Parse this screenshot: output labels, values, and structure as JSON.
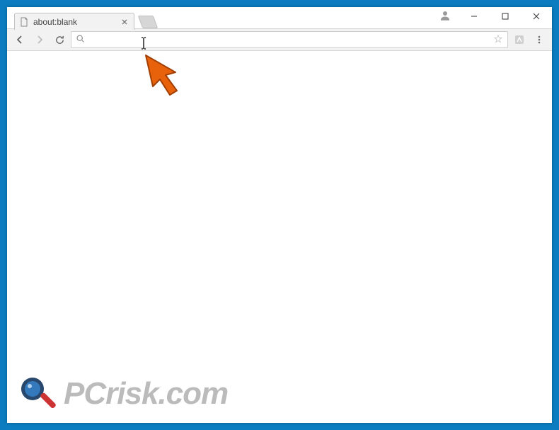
{
  "tab": {
    "title": "about:blank"
  },
  "omnibox": {
    "value": "",
    "placeholder": ""
  },
  "watermark": {
    "text": "PCrisk.com"
  }
}
